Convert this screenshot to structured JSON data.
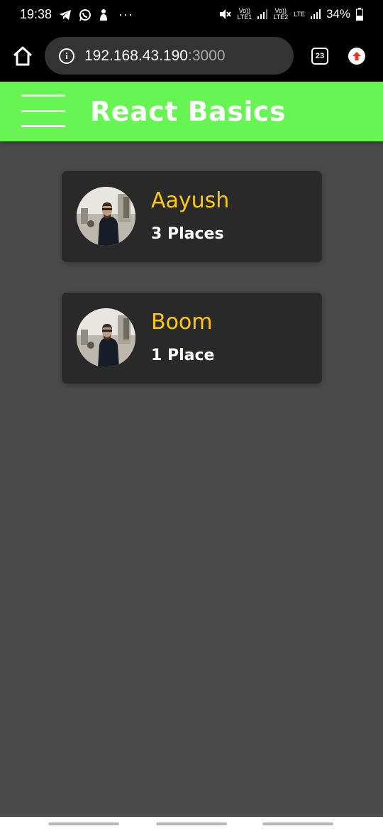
{
  "status_bar": {
    "time": "19:38",
    "sim1_top": "Vo))",
    "sim1_bottom": "LTE1",
    "sim2_top": "Vo))",
    "sim2_bottom": "LTE2",
    "net_type": "LTE",
    "battery": "34%",
    "icons": [
      "telegram-icon",
      "whatsapp-icon",
      "notification-icon",
      "more-icon",
      "mute-icon",
      "signal-icon",
      "battery-icon"
    ]
  },
  "browser": {
    "url_host": "192.168.43.190",
    "url_port": ":3000",
    "tab_count": "23",
    "icons": [
      "home-icon",
      "info-icon",
      "update-icon"
    ]
  },
  "app": {
    "title": "React Basics",
    "header_color": "#66f553",
    "name_color": "#ffc90a",
    "users": [
      {
        "name": "Aayush",
        "places": "3 Places"
      },
      {
        "name": "Boom",
        "places": "1 Place"
      }
    ]
  }
}
